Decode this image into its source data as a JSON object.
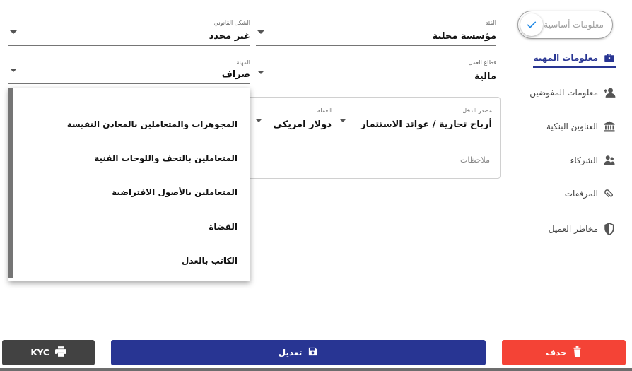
{
  "sidebar": {
    "step_label": "معلومات أساسية",
    "items": [
      {
        "label": "معلومات المهنة",
        "icon": "briefcase-icon",
        "active": true
      },
      {
        "label": "معلومات المفوضين",
        "icon": "user-plus-icon",
        "active": false
      },
      {
        "label": "العناوين البنكية",
        "icon": "bank-icon",
        "active": false
      },
      {
        "label": "الشركاء",
        "icon": "partners-icon",
        "active": false
      },
      {
        "label": "المرفقات",
        "icon": "paperclip-icon",
        "active": false
      },
      {
        "label": "مخاطر العميل",
        "icon": "shield-icon",
        "active": false
      }
    ]
  },
  "form": {
    "category": {
      "label": "الفئة",
      "value": "مؤسسة محلية"
    },
    "legal_form": {
      "label": "الشكل القانوني",
      "value": "غير محدد"
    },
    "sector": {
      "label": "قطاع العمل",
      "value": "مالية"
    },
    "profession": {
      "label": "المهنة",
      "value": "صراف"
    },
    "income_source": {
      "label": "مصدر الدخل",
      "value": "أرباح تجارية / عوائد الاستثمار"
    },
    "currency": {
      "label": "العملة",
      "value": "دولار امريكي"
    },
    "notes": {
      "placeholder": "ملاحظات"
    }
  },
  "dropdown": {
    "options": [
      "المجوهرات والمتعاملين بالمعادن النفيسة",
      "المتعاملين بالتحف واللوحات الفنية",
      "المتعاملين بالأصول الافتراضية",
      "القضاة",
      "الكاتب بالعدل"
    ]
  },
  "buttons": {
    "delete": "حذف",
    "edit": "تعديل",
    "kyc": "KYC"
  },
  "colors": {
    "primary": "#283593",
    "danger": "#f44336",
    "dark": "#424242"
  }
}
